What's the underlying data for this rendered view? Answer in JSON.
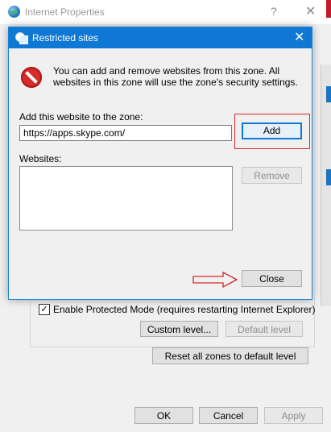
{
  "parent_window": {
    "title": "Internet Properties",
    "help_symbol": "?",
    "close_symbol": "✕",
    "protected_mode_label": "Enable Protected Mode (requires restarting Internet Explorer)",
    "protected_mode_checked": true,
    "custom_level_button": "Custom level...",
    "default_level_button": "Default level",
    "reset_all_button": "Reset all zones to default level",
    "ok_button": "OK",
    "cancel_button": "Cancel",
    "apply_button": "Apply"
  },
  "dialog": {
    "title": "Restricted sites",
    "close_symbol": "✕",
    "info_text": "You can add and remove websites from this zone. All websites in this zone will use the zone's security settings.",
    "add_label": "Add this website to the zone:",
    "url_value": "https://apps.skype.com/",
    "add_button": "Add",
    "websites_label": "Websites:",
    "websites": [],
    "remove_button": "Remove",
    "close_button": "Close"
  },
  "colors": {
    "titlebar_accent": "#0f78d4",
    "highlight_red": "#d22a2a"
  }
}
